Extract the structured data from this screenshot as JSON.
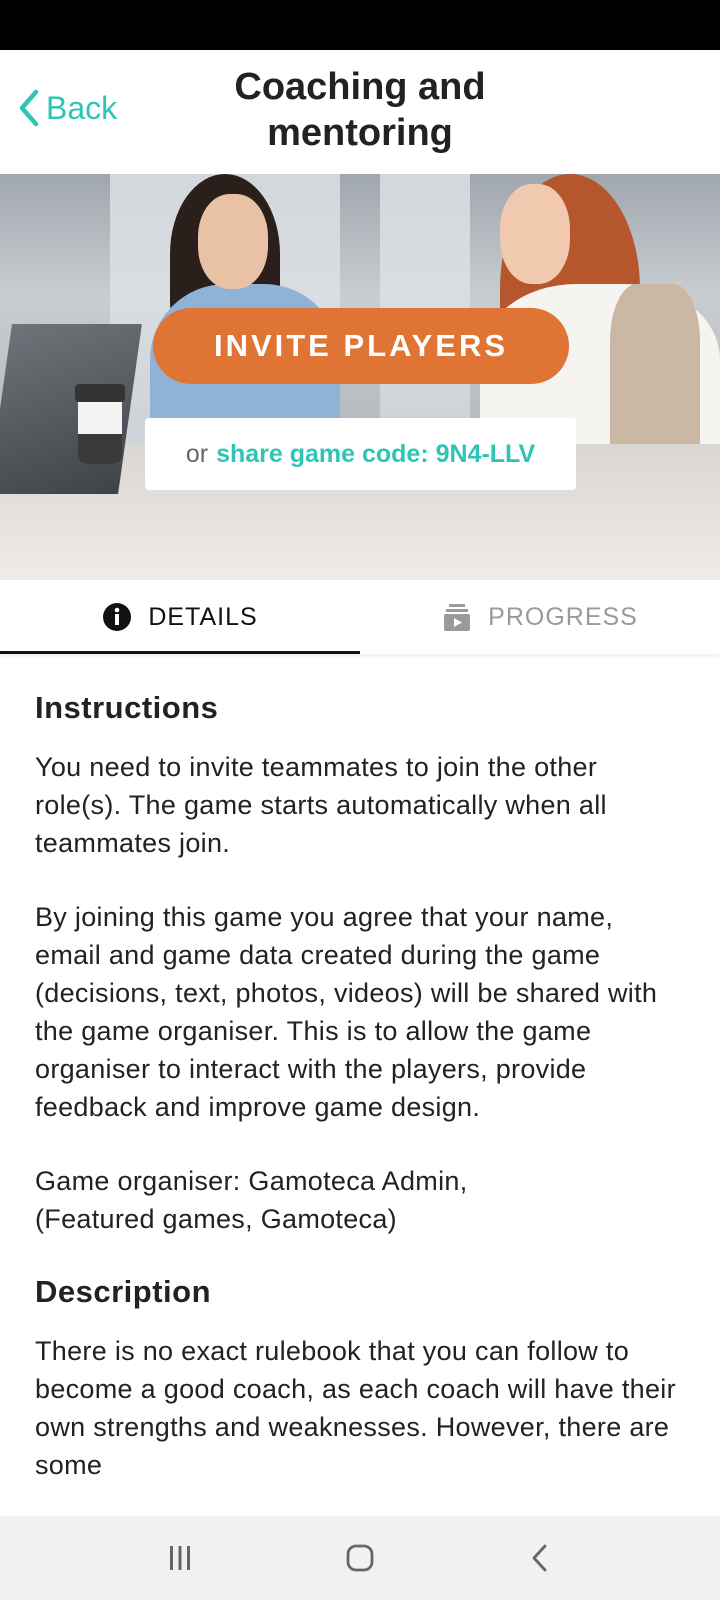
{
  "header": {
    "back_label": "Back",
    "title": "Coaching and mentoring"
  },
  "hero": {
    "invite_label": "INVITE PLAYERS",
    "share_prefix": "or",
    "share_code_text": "share game code: 9N4-LLV"
  },
  "tabs": [
    {
      "label": "DETAILS",
      "icon": "info-icon",
      "active": true
    },
    {
      "label": "PROGRESS",
      "icon": "progress-icon",
      "active": false
    }
  ],
  "content": {
    "instructions_heading": "Instructions",
    "instructions_p1": "You need to invite teammates to join the other role(s). The game starts automatically when all teammates join.",
    "instructions_p2": "By joining this game you agree that your name, email and game data created during the game (decisions, text, photos, videos) will be shared with the game organiser. This is to allow the game organiser to interact with the players, provide feedback and improve game design.",
    "organiser_line1": "Game organiser: Gamoteca Admin,",
    "organiser_line2": "(Featured games, Gamoteca)",
    "description_heading": "Description",
    "description_p1": "There is no exact rulebook that you can follow to become a good coach, as each coach will have their own strengths and weaknesses. However, there are some"
  },
  "nav": {
    "recent_icon": "recent-apps-icon",
    "home_icon": "home-icon",
    "back_icon": "back-nav-icon"
  },
  "colors": {
    "accent": "#2ec4b6",
    "invite": "#e07434"
  }
}
